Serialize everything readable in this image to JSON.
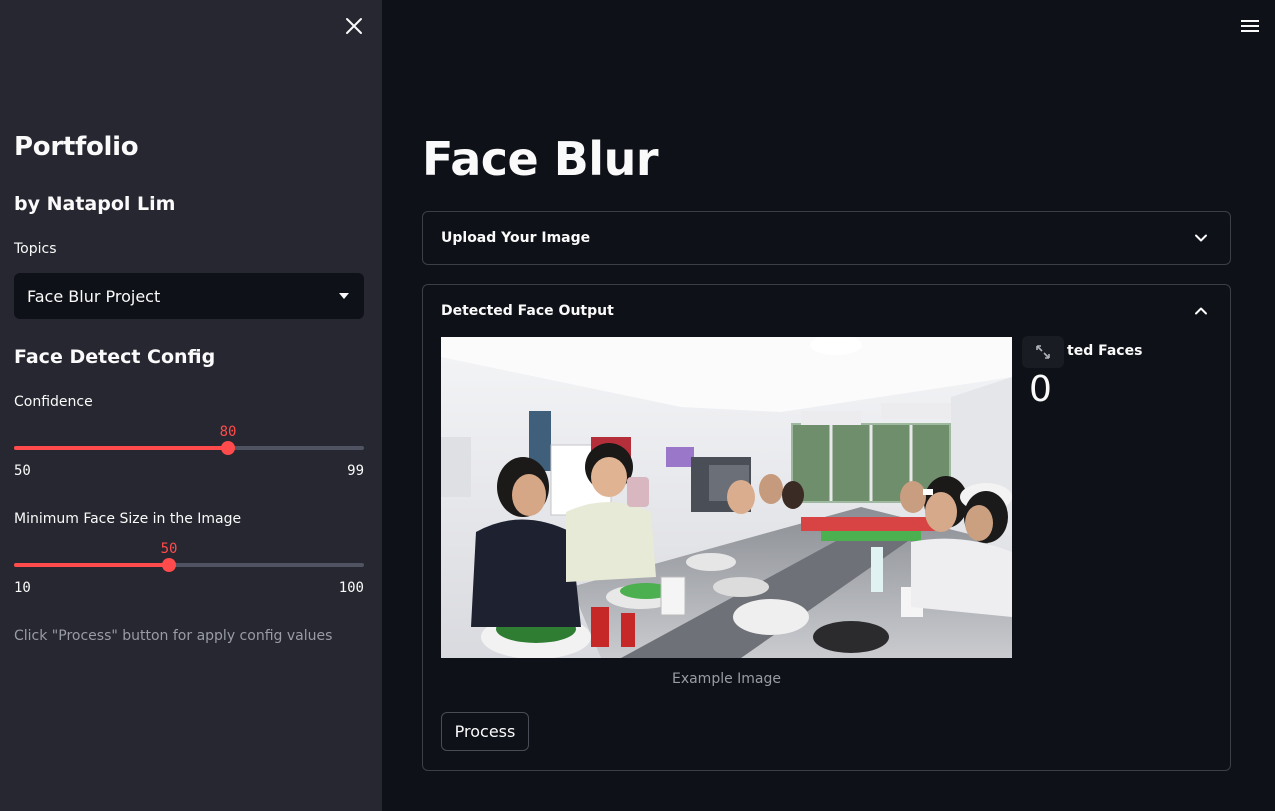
{
  "sidebar": {
    "title": "Portfolio",
    "author": "by Natapol Lim",
    "topics_label": "Topics",
    "topics_selected": "Face Blur Project",
    "config_title": "Face Detect Config",
    "confidence": {
      "label": "Confidence",
      "value": "80",
      "min": "50",
      "max": "99"
    },
    "min_face": {
      "label": "Minimum Face Size in the Image",
      "value": "50",
      "min": "10",
      "max": "100"
    },
    "hint": "Click \"Process\" button for apply config values"
  },
  "main": {
    "title": "Face Blur",
    "upload": {
      "label": "Upload Your Image"
    },
    "output": {
      "label": "Detected Face Output",
      "caption": "Example Image",
      "metric_label": "ted Faces",
      "metric_value": "0",
      "process_label": "Process"
    }
  },
  "colors": {
    "accent": "#ff4b4b",
    "sidebar_bg": "#262730",
    "main_bg": "#0e1117"
  },
  "icons": [
    "close-icon",
    "hamburger-menu-icon",
    "caret-down-icon",
    "chevron-down-icon",
    "chevron-up-icon",
    "fullscreen-icon"
  ]
}
